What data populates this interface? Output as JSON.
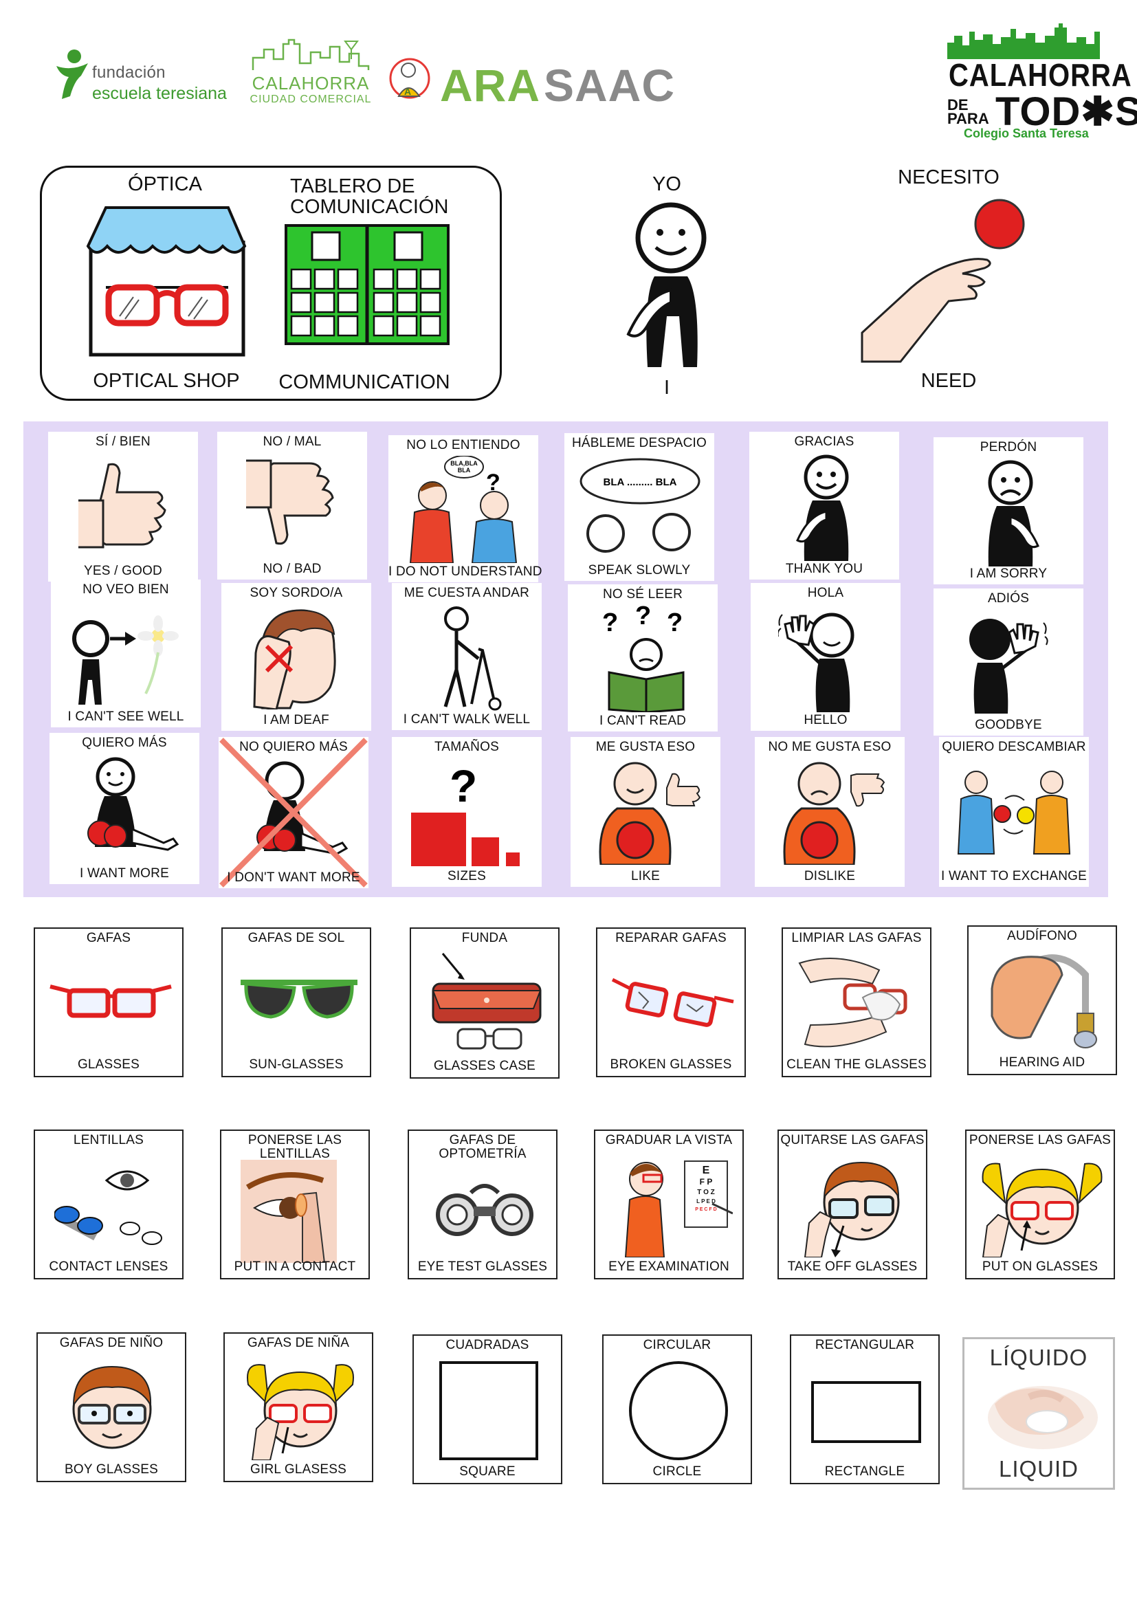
{
  "logos": {
    "fet_line1": "fundación",
    "fet_line2": "escuela teresiana",
    "calahorra_line1": "CALAHORRA",
    "calahorra_line2": "CIUDAD COMERCIAL",
    "arasaac_part1": "ARA",
    "arasaac_part2": "SAAC",
    "cpt_line1": "CALAHORRA",
    "cpt_de": "DE",
    "cpt_para": "PARA",
    "cpt_todos": "TOD✱S",
    "cpt_school": "Colegio Santa Teresa"
  },
  "header": {
    "optica": "ÓPTICA",
    "optical_shop": "OPTICAL SHOP",
    "tablero": "TABLERO DE\nCOMUNICACIÓN",
    "communication": "COMMUNICATION",
    "yo": "YO",
    "i": "I",
    "necesito": "NECESITO",
    "need": "NEED"
  },
  "phrases": [
    {
      "top": "SÍ / BIEN",
      "bottom": "YES / GOOD"
    },
    {
      "top": "NO / MAL",
      "bottom": "NO / BAD"
    },
    {
      "top": "NO LO ENTIENDO",
      "bottom": "I DO NOT UNDERSTAND"
    },
    {
      "top": "HÁBLEME DESPACIO",
      "bottom": "SPEAK SLOWLY"
    },
    {
      "top": "GRACIAS",
      "bottom": "THANK YOU"
    },
    {
      "top": "PERDÓN",
      "bottom": "I AM SORRY"
    },
    {
      "top": "NO VEO BIEN",
      "bottom": "I CAN'T SEE WELL"
    },
    {
      "top": "SOY SORDO/A",
      "bottom": "I AM DEAF"
    },
    {
      "top": "ME CUESTA ANDAR",
      "bottom": "I CAN'T WALK WELL"
    },
    {
      "top": "NO SÉ LEER",
      "bottom": "I CAN'T READ"
    },
    {
      "top": "HOLA",
      "bottom": "HELLO"
    },
    {
      "top": "ADIÓS",
      "bottom": "GOODBYE"
    },
    {
      "top": "QUIERO MÁS",
      "bottom": "I WANT MORE"
    },
    {
      "top": "NO QUIERO MÁS",
      "bottom": "I DON'T WANT MORE"
    },
    {
      "top": "TAMAÑOS",
      "bottom": "SIZES"
    },
    {
      "top": "ME GUSTA ESO",
      "bottom": "LIKE"
    },
    {
      "top": "NO ME GUSTA ESO",
      "bottom": "DISLIKE"
    },
    {
      "top": "QUIERO DESCAMBIAR",
      "bottom": "I WANT TO EXCHANGE"
    }
  ],
  "bubble_text": {
    "bla3": "BLA,BLA\nBLA",
    "slow": "BLA .......... BLA"
  },
  "vocab": [
    {
      "top": "GAFAS",
      "bottom": "GLASSES"
    },
    {
      "top": "GAFAS DE SOL",
      "bottom": "SUN-GLASSES"
    },
    {
      "top": "FUNDA",
      "bottom": "GLASSES CASE"
    },
    {
      "top": "REPARAR GAFAS",
      "bottom": "BROKEN GLASSES"
    },
    {
      "top": "LIMPIAR LAS GAFAS",
      "bottom": "CLEAN THE GLASSES"
    },
    {
      "top": "AUDÍFONO",
      "bottom": "HEARING AID"
    },
    {
      "top": "LENTILLAS",
      "bottom": "CONTACT LENSES"
    },
    {
      "top": "PONERSE LAS\nLENTILLAS",
      "bottom": "PUT IN A CONTACT"
    },
    {
      "top": "GAFAS DE\nOPTOMETRÍA",
      "bottom": "EYE TEST GLASSES"
    },
    {
      "top": "GRADUAR LA VISTA",
      "bottom": "EYE EXAMINATION"
    },
    {
      "top": "QUITARSE LAS GAFAS",
      "bottom": "TAKE OFF GLASSES"
    },
    {
      "top": "PONERSE LAS GAFAS",
      "bottom": "PUT ON GLASSES"
    },
    {
      "top": "GAFAS DE NIÑO",
      "bottom": "BOY GLASSES"
    },
    {
      "top": "GAFAS DE NIÑA",
      "bottom": "GIRL GLASESS"
    },
    {
      "top": "CUADRADAS",
      "bottom": "SQUARE"
    },
    {
      "top": "CIRCULAR",
      "bottom": "CIRCLE"
    },
    {
      "top": "RECTANGULAR",
      "bottom": "RECTANGLE"
    },
    {
      "top": "LÍQUIDO",
      "bottom": "LIQUID"
    }
  ],
  "eye_chart": [
    "E",
    "F P",
    "T O Z",
    "L P E D",
    "P E C F D"
  ],
  "colors": {
    "purple_bg": "#e3d8f7",
    "green": "#3d9a2e",
    "red": "#e02020",
    "orange": "#f06020"
  }
}
